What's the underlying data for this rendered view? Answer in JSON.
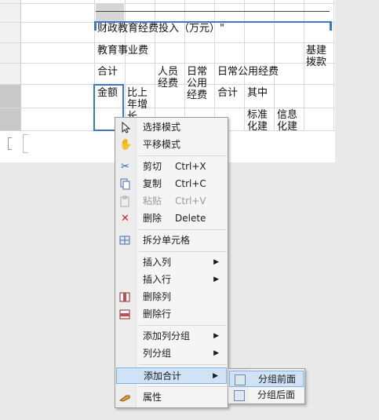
{
  "sheet": {
    "title_text": "财政教育经费投入（万元）\"",
    "cells": {
      "edu_business": "教育事业费",
      "basic_construction": "基建\n拨款",
      "subtotal": "合计",
      "personnel": "人员\n经费",
      "daily_public": "日常\n公用\n经费",
      "daily_public_expense": "日常公用经费",
      "amount": "金额",
      "yoy_increase": "比上\n年增\n长",
      "total2": "合计",
      "among": "其中",
      "standard": "标准\n化建",
      "info": "信息\n化建"
    }
  },
  "context_menu": {
    "items": [
      {
        "label": "选择模式",
        "shortcut": "",
        "icon": "cursor-icon",
        "submenu": false,
        "disabled": false
      },
      {
        "label": "平移模式",
        "shortcut": "",
        "icon": "hand-icon",
        "submenu": false,
        "disabled": false
      },
      {
        "label": "剪切",
        "shortcut": "Ctrl+X",
        "icon": "scissors-icon",
        "submenu": false,
        "disabled": false
      },
      {
        "label": "复制",
        "shortcut": "Ctrl+C",
        "icon": "copy-icon",
        "submenu": false,
        "disabled": false
      },
      {
        "label": "粘贴",
        "shortcut": "Ctrl+V",
        "icon": "paste-icon",
        "submenu": false,
        "disabled": true
      },
      {
        "label": "删除",
        "shortcut": "Delete",
        "icon": "delete-x-icon",
        "submenu": false,
        "disabled": false
      },
      {
        "label": "拆分单元格",
        "shortcut": "",
        "icon": "split-cells-icon",
        "submenu": false,
        "disabled": false
      },
      {
        "label": "插入列",
        "shortcut": "",
        "icon": "",
        "submenu": true,
        "disabled": false
      },
      {
        "label": "插入行",
        "shortcut": "",
        "icon": "",
        "submenu": true,
        "disabled": false
      },
      {
        "label": "删除列",
        "shortcut": "",
        "icon": "delete-column-icon",
        "submenu": false,
        "disabled": false
      },
      {
        "label": "删除行",
        "shortcut": "",
        "icon": "delete-row-icon",
        "submenu": false,
        "disabled": false
      },
      {
        "label": "添加列分组",
        "shortcut": "",
        "icon": "",
        "submenu": true,
        "disabled": false
      },
      {
        "label": "列分组",
        "shortcut": "",
        "icon": "",
        "submenu": true,
        "disabled": false
      },
      {
        "label": "添加合计",
        "shortcut": "",
        "icon": "",
        "submenu": true,
        "disabled": false
      },
      {
        "label": "属性",
        "shortcut": "",
        "icon": "properties-icon",
        "submenu": false,
        "disabled": false
      }
    ],
    "arrow": "▶"
  },
  "submenu": {
    "items": [
      {
        "label": "分组前面",
        "icon": "group-before-icon"
      },
      {
        "label": "分组后面",
        "icon": "group-after-icon"
      }
    ]
  },
  "colors": {
    "selection": "#3b78c6",
    "highlight": "#cfe2f6"
  }
}
